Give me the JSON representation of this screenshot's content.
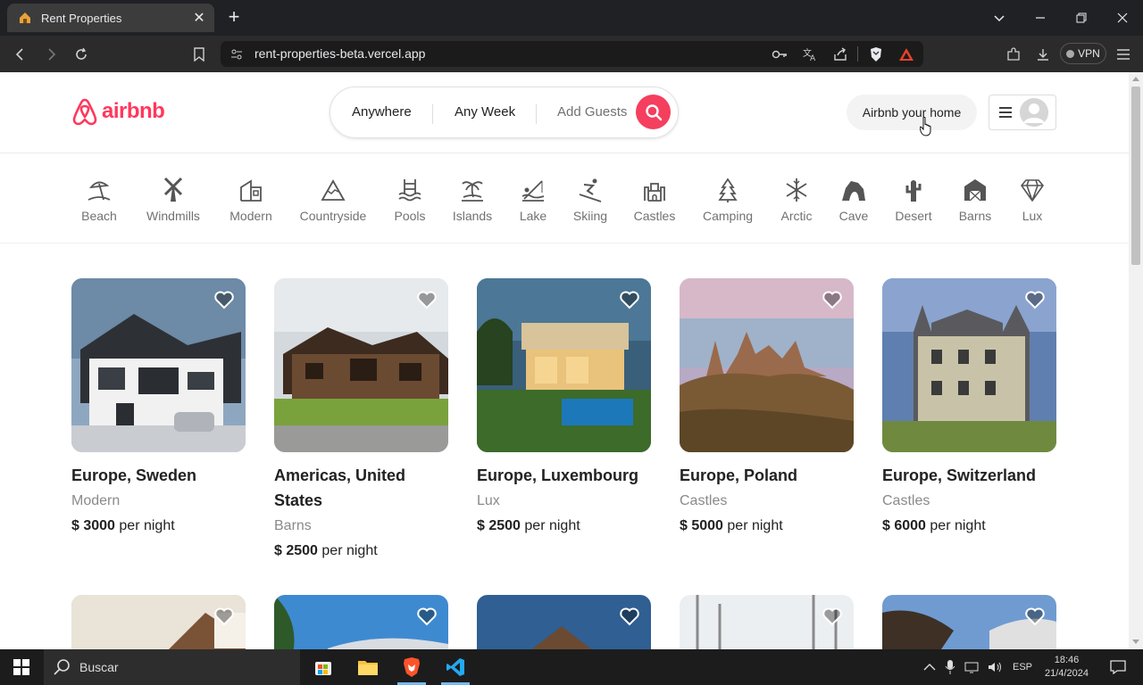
{
  "browser": {
    "tab_title": "Rent Properties",
    "url": "rent-properties-beta.vercel.app",
    "vpn_label": "VPN"
  },
  "header": {
    "logo_text": "airbnb",
    "search": {
      "anywhere": "Anywhere",
      "any_week": "Any Week",
      "add_guests": "Add Guests"
    },
    "host_button": "Airbnb your home"
  },
  "categories": [
    {
      "label": "Beach",
      "icon": "beach-icon"
    },
    {
      "label": "Windmills",
      "icon": "windmill-icon"
    },
    {
      "label": "Modern",
      "icon": "modern-building-icon"
    },
    {
      "label": "Countryside",
      "icon": "mountain-icon"
    },
    {
      "label": "Pools",
      "icon": "pool-icon"
    },
    {
      "label": "Islands",
      "icon": "island-icon"
    },
    {
      "label": "Lake",
      "icon": "lake-fishing-icon"
    },
    {
      "label": "Skiing",
      "icon": "skiing-icon"
    },
    {
      "label": "Castles",
      "icon": "castle-icon"
    },
    {
      "label": "Camping",
      "icon": "tree-tent-icon"
    },
    {
      "label": "Arctic",
      "icon": "snowflake-icon"
    },
    {
      "label": "Cave",
      "icon": "cave-icon"
    },
    {
      "label": "Desert",
      "icon": "cactus-icon"
    },
    {
      "label": "Barns",
      "icon": "barn-icon"
    },
    {
      "label": "Lux",
      "icon": "diamond-icon"
    }
  ],
  "listings": [
    {
      "location": "Europe, Sweden",
      "category": "Modern",
      "price": "$ 3000",
      "per_night": "per night"
    },
    {
      "location": "Americas, United States",
      "category": "Barns",
      "price": "$ 2500",
      "per_night": "per night"
    },
    {
      "location": "Europe, Luxembourg",
      "category": "Lux",
      "price": "$ 2500",
      "per_night": "per night"
    },
    {
      "location": "Europe, Poland",
      "category": "Castles",
      "price": "$ 5000",
      "per_night": "per night"
    },
    {
      "location": "Europe, Switzerland",
      "category": "Castles",
      "price": "$ 6000",
      "per_night": "per night"
    }
  ],
  "taskbar": {
    "search_placeholder": "Buscar",
    "language": "ESP",
    "time": "18:46",
    "date": "21/4/2024"
  },
  "colors": {
    "brand": "#ff385c",
    "search_button": "#f43f5e"
  }
}
